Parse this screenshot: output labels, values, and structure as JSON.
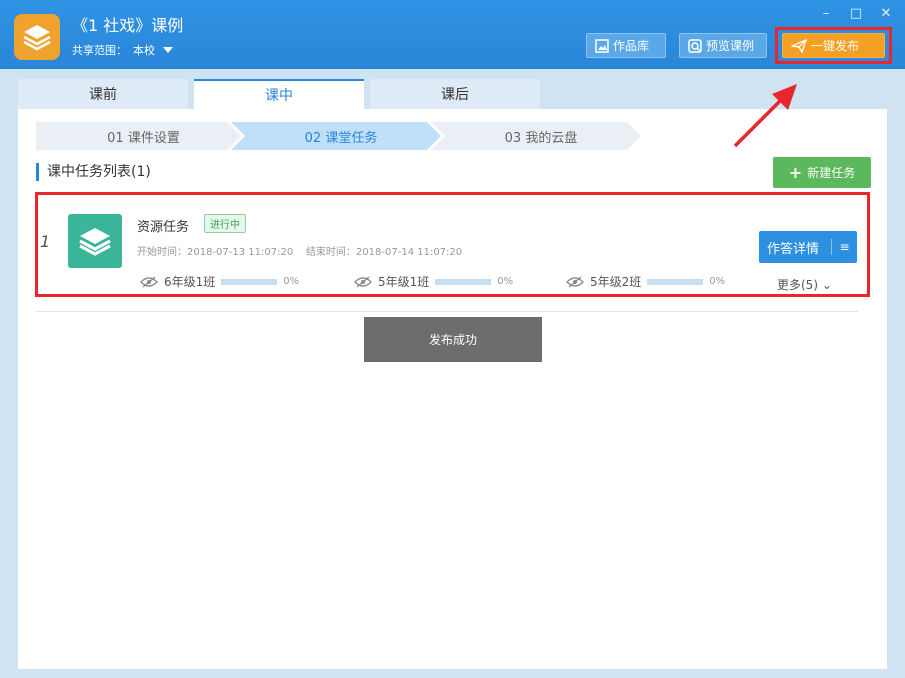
{
  "window": {
    "title": "《1 社戏》课例",
    "scope_label": "共享范围：",
    "scope_value": "本校",
    "controls": {
      "minimize": "–",
      "maximize": "□",
      "close": "✕"
    }
  },
  "toolbar": {
    "works_label": "作品库",
    "preview_label": "预览课例",
    "publish_label": "一键发布"
  },
  "tabs": [
    {
      "label": "课前"
    },
    {
      "label": "课中"
    },
    {
      "label": "课后"
    }
  ],
  "steps": [
    {
      "label": "01 课件设置"
    },
    {
      "label": "02 课堂任务"
    },
    {
      "label": "03 我的云盘"
    }
  ],
  "section": {
    "title": "课中任务列表(1)",
    "new_task_label": "新建任务"
  },
  "task": {
    "index": "1",
    "name": "资源任务",
    "status": "进行中",
    "start_time": "开始时间：2018-07-13 11:07:20",
    "end_time": "结束时间：2018-07-14 11:07:20",
    "classes": [
      {
        "name": "6年级1班",
        "progress": "0%"
      },
      {
        "name": "5年级1班",
        "progress": "0%"
      },
      {
        "name": "5年级2班",
        "progress": "0%"
      }
    ],
    "detail_label": "作答详情",
    "more_label": "更多(5)"
  },
  "toast": {
    "message": "发布成功"
  },
  "colors": {
    "titlebar": "#2a86d9",
    "publish_button": "#f4a025",
    "highlight": "#e8262b",
    "task_icon": "#3bb59a",
    "new_task_button": "#5cb85c"
  }
}
